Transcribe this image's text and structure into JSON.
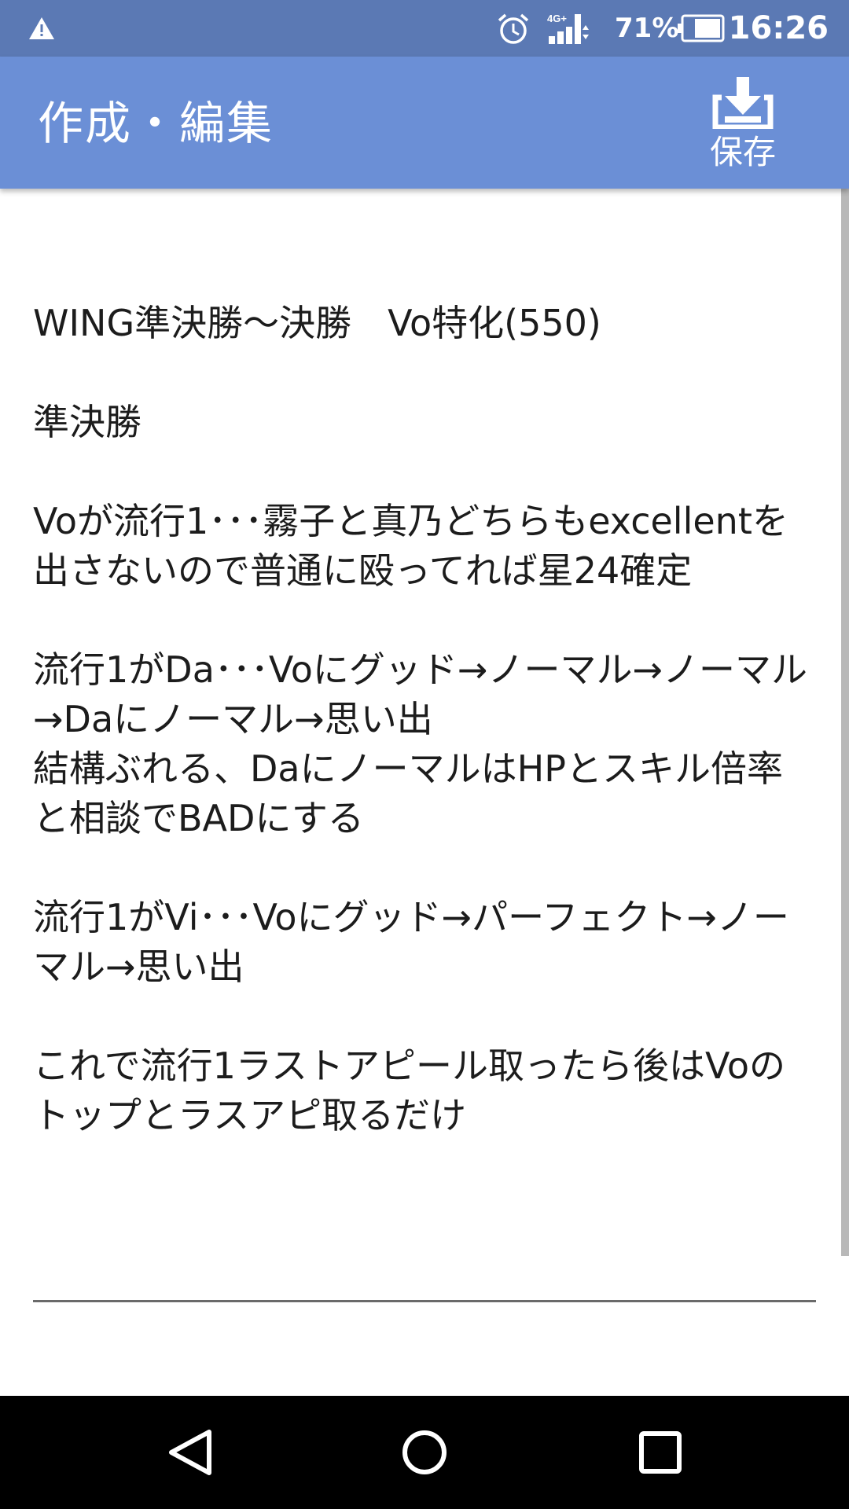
{
  "status_bar": {
    "battery_percent": "71%",
    "time": "16:26",
    "network": "4G+",
    "icons": [
      "warning-icon",
      "alarm-icon",
      "signal-icon",
      "battery-icon"
    ]
  },
  "app_bar": {
    "title": "作成・編集",
    "save_label": "保存",
    "save_icon": "download-icon"
  },
  "editor": {
    "text": "WING準決勝〜決勝　Vo特化(550)\n\n準決勝\n\nVoが流行1･･･霧子と真乃どちらもexcellentを出さないので普通に殴ってれば星24確定\n\n流行1がDa･･･Voにグッド→ノーマル→ノーマル→Daにノーマル→思い出\n結構ぶれる、DaにノーマルはHPとスキル倍率と相談でBADにする\n\n流行1がVi･･･Voにグッド→パーフェクト→ノーマル→思い出\n\nこれで流行1ラストアピール取ったら後はVoのトップとラスアピ取るだけ"
  },
  "nav_bar": {
    "icons": [
      "back-icon",
      "home-icon",
      "recents-icon"
    ]
  },
  "colors": {
    "status_bar": "#5b79b4",
    "app_bar": "#6b8fd6",
    "text": "#1c1c1c",
    "nav_bar": "#000000"
  }
}
